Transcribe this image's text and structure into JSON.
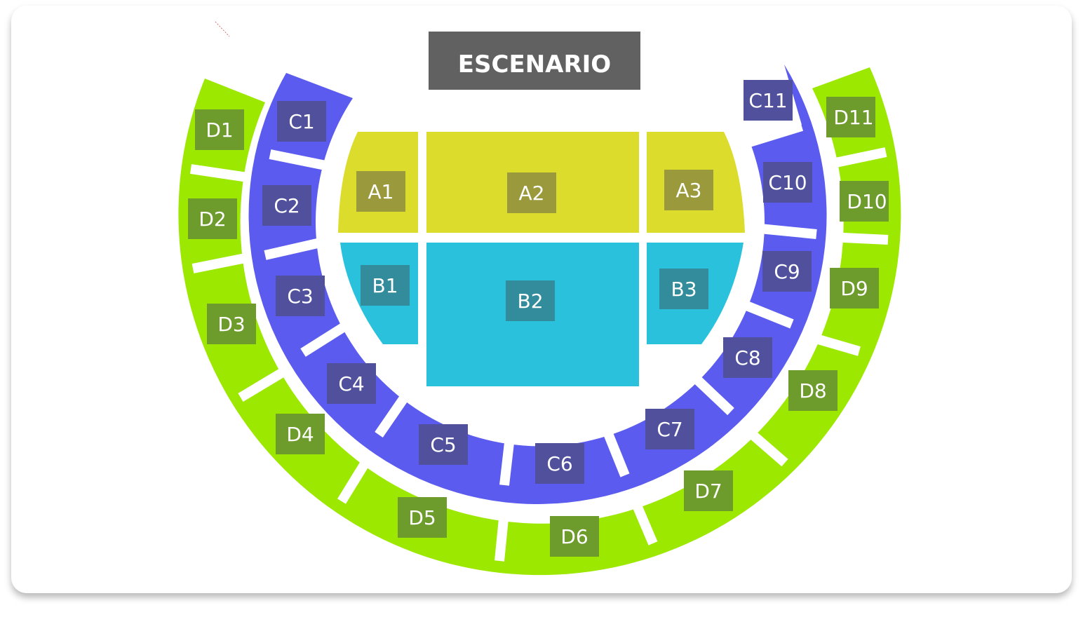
{
  "stage": {
    "label": "ESCENARIO",
    "color": "#616161"
  },
  "colors": {
    "a_fill": "#dcdc2c",
    "a_tag": "#9a9a3c",
    "b_fill": "#2ac1dc",
    "b_tag": "#338c9b",
    "c_fill": "#5b5bef",
    "c_tag": "#50509c",
    "d_fill": "#9ce800",
    "d_tag": "#6e9c2c",
    "divider": "#ffffff"
  },
  "sections": {
    "A1": "A1",
    "A2": "A2",
    "A3": "A3",
    "B1": "B1",
    "B2": "B2",
    "B3": "B3",
    "C1": "C1",
    "C2": "C2",
    "C3": "C3",
    "C4": "C4",
    "C5": "C5",
    "C6": "C6",
    "C7": "C7",
    "C8": "C8",
    "C9": "C9",
    "C10": "C10",
    "C11": "C11",
    "D1": "D1",
    "D2": "D2",
    "D3": "D3",
    "D4": "D4",
    "D5": "D5",
    "D6": "D6",
    "D7": "D7",
    "D8": "D8",
    "D9": "D9",
    "D10": "D10",
    "D11": "D11"
  }
}
